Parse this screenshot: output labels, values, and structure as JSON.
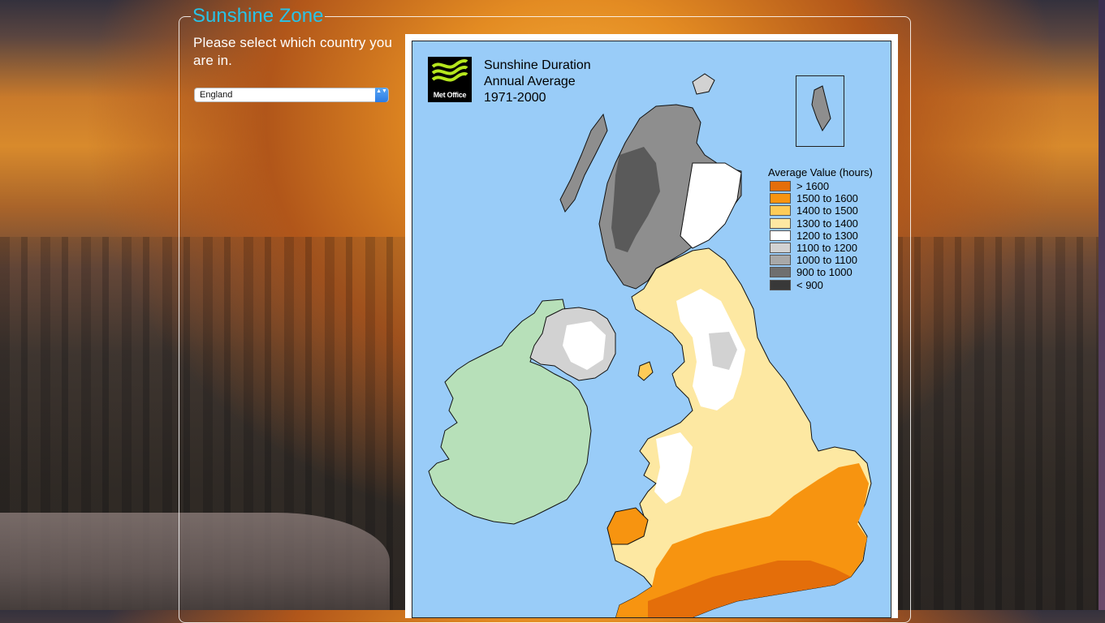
{
  "panel": {
    "legend": "Sunshine Zone"
  },
  "prompt": "Please select which country you are in.",
  "country_select": {
    "selected": "England",
    "arrows": "▲▼"
  },
  "map": {
    "logo_text": "Met Office",
    "title_lines": [
      "Sunshine Duration",
      "Annual Average",
      "1971-2000"
    ],
    "legend_title": "Average Value (hours)",
    "legend": [
      {
        "label": "> 1600",
        "color": "#e46e0a"
      },
      {
        "label": "1500 to 1600",
        "color": "#f79410"
      },
      {
        "label": "1400 to 1500",
        "color": "#fdcb58"
      },
      {
        "label": "1300 to 1400",
        "color": "#fde8a2"
      },
      {
        "label": "1200 to 1300",
        "color": "#ffffff"
      },
      {
        "label": "1100 to 1200",
        "color": "#d2d2d2"
      },
      {
        "label": "1000 to 1100",
        "color": "#a8a8a8"
      },
      {
        "label": "900 to 1000",
        "color": "#6f6f6f"
      },
      {
        "label": "< 900",
        "color": "#383838"
      }
    ],
    "colors": {
      "sea": "#99ccf8",
      "ireland": "#b7e0b9"
    }
  }
}
